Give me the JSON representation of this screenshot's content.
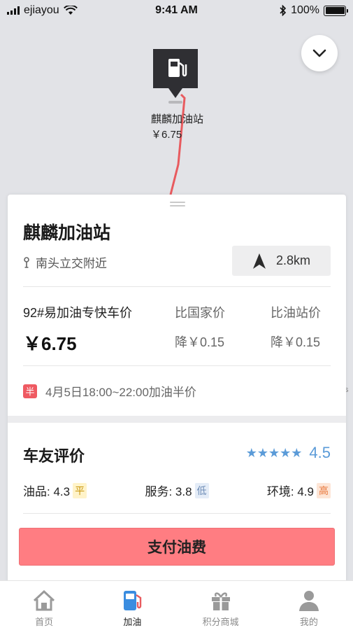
{
  "status_bar": {
    "carrier": "ejiayou",
    "time": "9:41 AM",
    "battery": "100%",
    "icons": [
      "signal-icon",
      "wifi-icon",
      "bluetooth-icon",
      "battery-icon"
    ]
  },
  "map": {
    "pin_name": "麒麟加油站",
    "pin_price": "￥6.75",
    "route_color": "#e85b5f",
    "icons": [
      "chevron-down-icon",
      "gas-pump-icon"
    ]
  },
  "station": {
    "name": "麒麟加油站",
    "location": "南头立交附近",
    "distance": "2.8km"
  },
  "pricing": {
    "product_label": "92#易加油专快车价",
    "price": "￥6.75",
    "compare_national_label": "比国家价",
    "compare_national_value": "降￥0.15",
    "compare_station_label": "比油站价",
    "compare_station_value": "降￥0.15"
  },
  "promotion": {
    "badge": "半",
    "text": "4月5日18:00~22:00加油半价"
  },
  "reviews": {
    "title": "车友评价",
    "stars": "★★★★★",
    "star_rating": 4.5,
    "rating": "4.5",
    "metrics": [
      {
        "label": "油品: 4.3",
        "tag": "平"
      },
      {
        "label": "服务: 3.8",
        "tag": "低"
      },
      {
        "label": "环境: 4.9",
        "tag": "高"
      }
    ]
  },
  "pay_button": "支付油费",
  "edge_char": "s",
  "tabs": [
    {
      "label": "首页",
      "icon": "home-icon"
    },
    {
      "label": "加油",
      "icon": "fuel-icon"
    },
    {
      "label": "积分商城",
      "icon": "gift-icon"
    },
    {
      "label": "我的",
      "icon": "profile-icon"
    }
  ],
  "colors": {
    "accent_blue": "#5b9bd8",
    "pay_button": "#ff7d82",
    "promo_badge": "#ef5a62",
    "active_tab": "#3a8de0"
  }
}
